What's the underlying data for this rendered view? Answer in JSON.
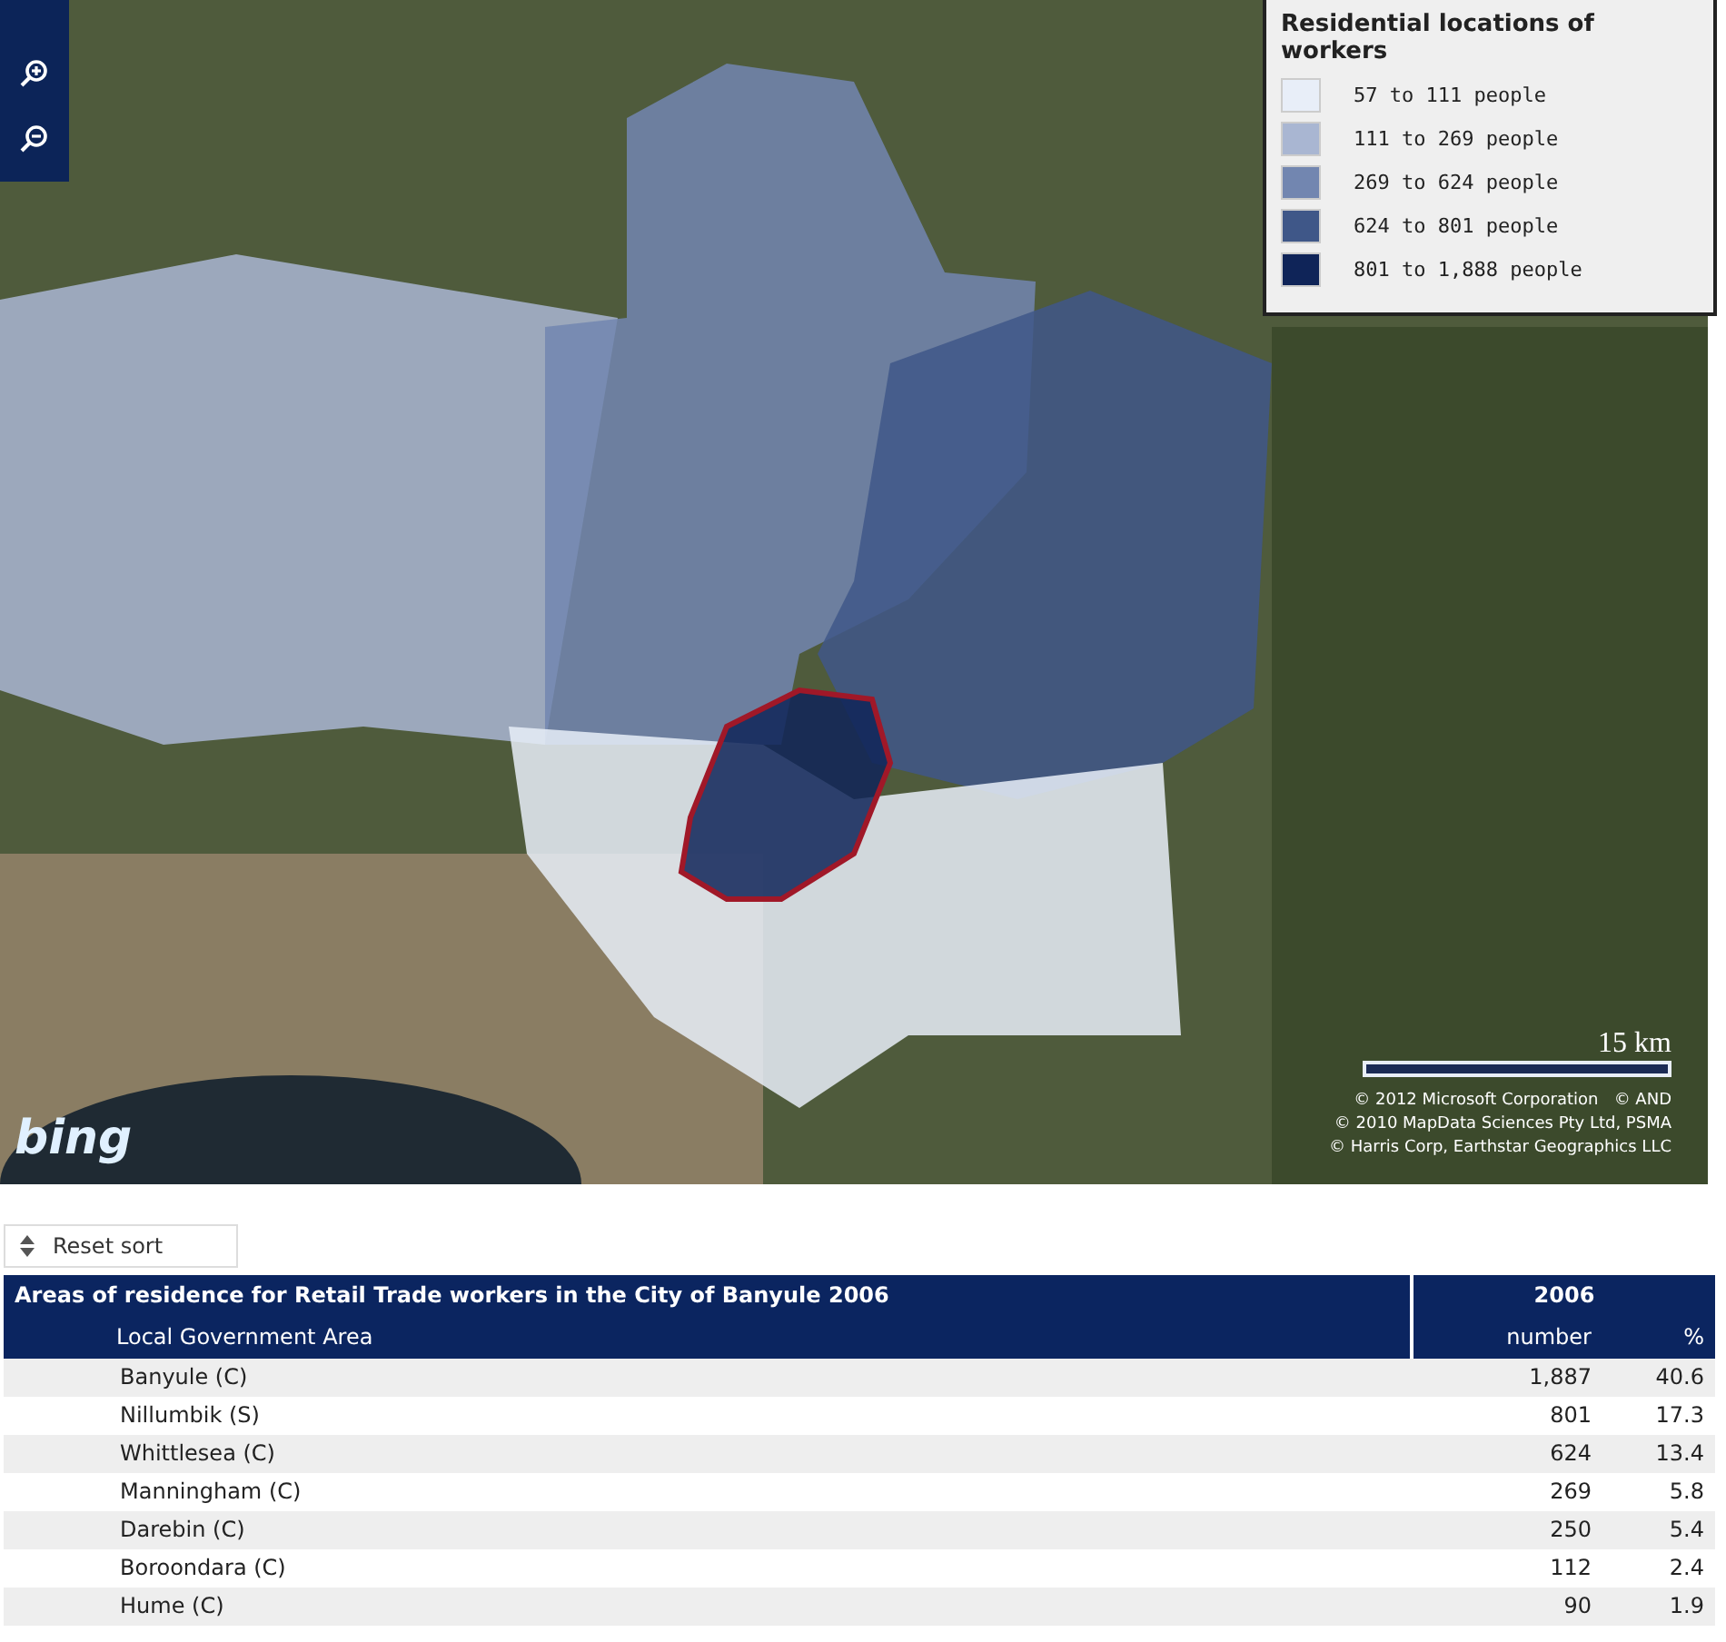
{
  "map": {
    "legend": {
      "title": "Residential locations of workers",
      "items": [
        {
          "label": "57 to 111 people",
          "color": "#e8eef8"
        },
        {
          "label": "111 to 269 people",
          "color": "#a9b6d2"
        },
        {
          "label": "269 to 624 people",
          "color": "#7286b0"
        },
        {
          "label": "624 to 801 people",
          "color": "#3f5788"
        },
        {
          "label": "801 to 1,888 people",
          "color": "#0f2458"
        }
      ]
    },
    "scale": "15 km",
    "logo": "bing",
    "copyright": [
      "© 2012 Microsoft Corporation   © AND",
      "© 2010 MapData Sciences Pty Ltd, PSMA",
      "© Harris Corp, Earthstar Geographics LLC"
    ]
  },
  "reset_sort": "Reset sort",
  "table": {
    "title": "Areas of residence for Retail Trade workers in the City of Banyule 2006",
    "year": "2006",
    "columns": [
      "Local Government Area",
      "number",
      "%"
    ],
    "rows": [
      [
        "Banyule (C)",
        "1,887",
        "40.6"
      ],
      [
        "Nillumbik (S)",
        "801",
        "17.3"
      ],
      [
        "Whittlesea (C)",
        "624",
        "13.4"
      ],
      [
        "Manningham (C)",
        "269",
        "5.8"
      ],
      [
        "Darebin (C)",
        "250",
        "5.4"
      ],
      [
        "Boroondara (C)",
        "112",
        "2.4"
      ],
      [
        "Hume (C)",
        "90",
        "1.9"
      ]
    ]
  }
}
